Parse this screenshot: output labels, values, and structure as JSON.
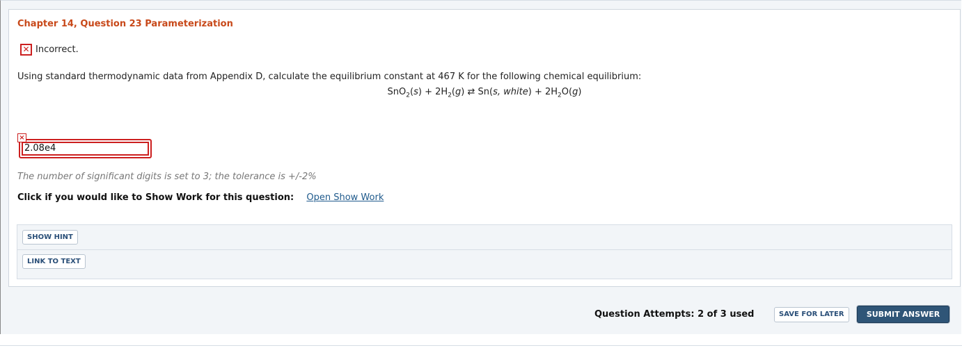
{
  "question": {
    "title": "Chapter 14, Question 23 Parameterization",
    "status_text": "Incorrect.",
    "prompt": "Using standard thermodynamic data from Appendix D, calculate the equilibrium constant at 467 K for the following chemical equilibrium:",
    "equation": {
      "r1": "SnO",
      "r1_sub": "2",
      "r1_state": "s",
      "plus1": "+",
      "r2": "2H",
      "r2_sub": "2",
      "r2_state": "g",
      "arrow": "⇄",
      "p1": "Sn",
      "p1_state": "s, white",
      "plus2": "+",
      "p2a": "2H",
      "p2_sub": "2",
      "p2b": "O",
      "p2_state": "g"
    }
  },
  "answer": {
    "value": "2.08e4",
    "mark": "×",
    "tolerance_text": "The number of significant digits is set to 3; the tolerance is +/-2%"
  },
  "show_work": {
    "label": "Click if you would like to Show Work for this question:",
    "link": "Open Show Work"
  },
  "tools": {
    "hint_label": "SHOW HINT",
    "link_label": "LINK TO TEXT"
  },
  "footer": {
    "attempts": "Question Attempts: 2 of 3 used",
    "save_label": "SAVE FOR LATER",
    "submit_label": "SUBMIT ANSWER"
  },
  "colors": {
    "title": "#c8491a",
    "error": "#cc1f1f",
    "submit_bg": "#2f5577",
    "link": "#1f5a8c"
  }
}
